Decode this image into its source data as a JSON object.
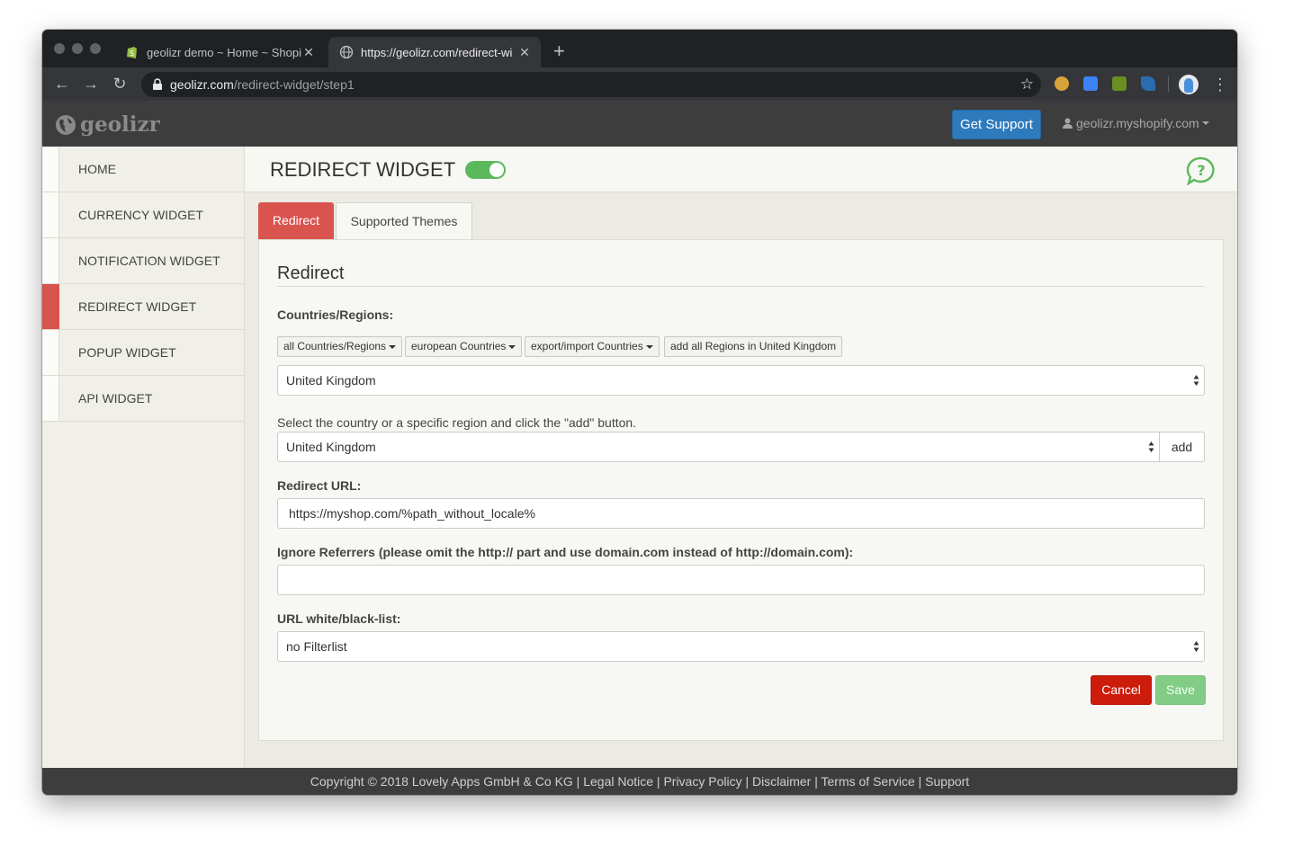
{
  "browser": {
    "tabs": [
      {
        "title": "geolizr demo ~ Home ~ Shopif",
        "close": "✕"
      },
      {
        "title": "https://geolizr.com/redirect-wi",
        "close": "✕"
      }
    ],
    "new_tab": "+",
    "address": {
      "host": "geolizr.com",
      "path": "/redirect-widget/step1"
    }
  },
  "app": {
    "logo": "geolizr",
    "support_label": "Get Support",
    "account_label": "geolizr.myshopify.com"
  },
  "sidebar": {
    "items": [
      {
        "label": "HOME",
        "active": false
      },
      {
        "label": "CURRENCY WIDGET",
        "active": false
      },
      {
        "label": "NOTIFICATION WIDGET",
        "active": false
      },
      {
        "label": "REDIRECT WIDGET",
        "active": true
      },
      {
        "label": "POPUP WIDGET",
        "active": false
      },
      {
        "label": "API WIDGET",
        "active": false
      }
    ]
  },
  "page": {
    "title": "REDIRECT WIDGET",
    "enabled": true,
    "tabs": [
      {
        "label": "Redirect",
        "active": true
      },
      {
        "label": "Supported Themes",
        "active": false
      }
    ]
  },
  "form": {
    "heading": "Redirect",
    "countries_label": "Countries/Regions:",
    "quick_buttons": [
      "all Countries/Regions",
      "european Countries",
      "export/import Countries",
      "add all Regions in United Kingdom"
    ],
    "selected_country": "United Kingdom",
    "select_hint": "Select the country or a specific region and click the \"add\" button.",
    "region_select": "United Kingdom",
    "add_label": "add",
    "redirect_url_label": "Redirect URL:",
    "redirect_url_value": "https://myshop.com/%path_without_locale%",
    "referrers_label": "Ignore Referrers (please omit the http:// part and use domain.com instead of http://domain.com):",
    "referrers_value": "",
    "filter_label": "URL white/black-list:",
    "filter_value": "no Filterlist",
    "cancel_label": "Cancel",
    "save_label": "Save"
  },
  "footer": {
    "text": "Copyright © 2018 Lovely Apps GmbH & Co KG | Legal Notice | Privacy Policy | Disclaimer | Terms of Service | Support"
  },
  "colors": {
    "accent_red": "#d9534f",
    "support_blue": "#2d7bbd",
    "toggle_green": "#5cb85c",
    "cancel_red": "#cc1c0c",
    "save_green": "#82cc85"
  }
}
